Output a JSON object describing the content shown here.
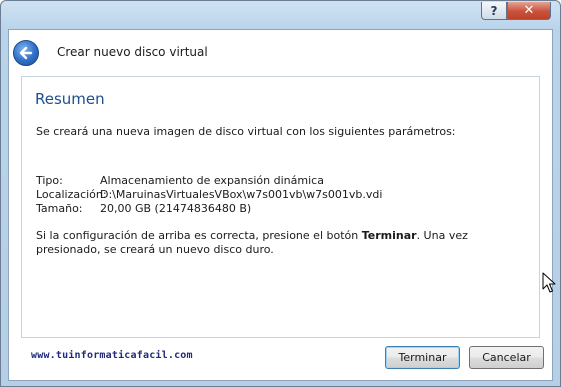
{
  "titlebar": {
    "help_label": "?",
    "close_label": "✕"
  },
  "header": {
    "title": "Crear nuevo disco virtual",
    "back_icon": "back-arrow-icon"
  },
  "summary": {
    "title": "Resumen",
    "intro": "Se creará una nueva imagen de disco virtual con los siguientes parámetros:",
    "rows": [
      {
        "label": "Tipo:",
        "value": "Almacenamiento de expansión dinámica"
      },
      {
        "label": "Localización:",
        "value": "D:\\MaruinasVirtualesVBox\\w7s001vb\\w7s001vb.vdi"
      },
      {
        "label": "Tamaño:",
        "value": "20,00 GB (21474836480 B)"
      }
    ],
    "note_before": "Si la configuración de arriba es correcta, presione el botón ",
    "note_bold": "Terminar",
    "note_after": ". Una vez presionado, se creará un nuevo disco duro."
  },
  "footer": {
    "watermark": "www.tuinformaticafacil.com",
    "finish_label": "Terminar",
    "cancel_label": "Cancelar"
  },
  "colors": {
    "accent_title": "#1e4f91",
    "frame": "#b9d3ea",
    "close_button": "#c9523c"
  }
}
